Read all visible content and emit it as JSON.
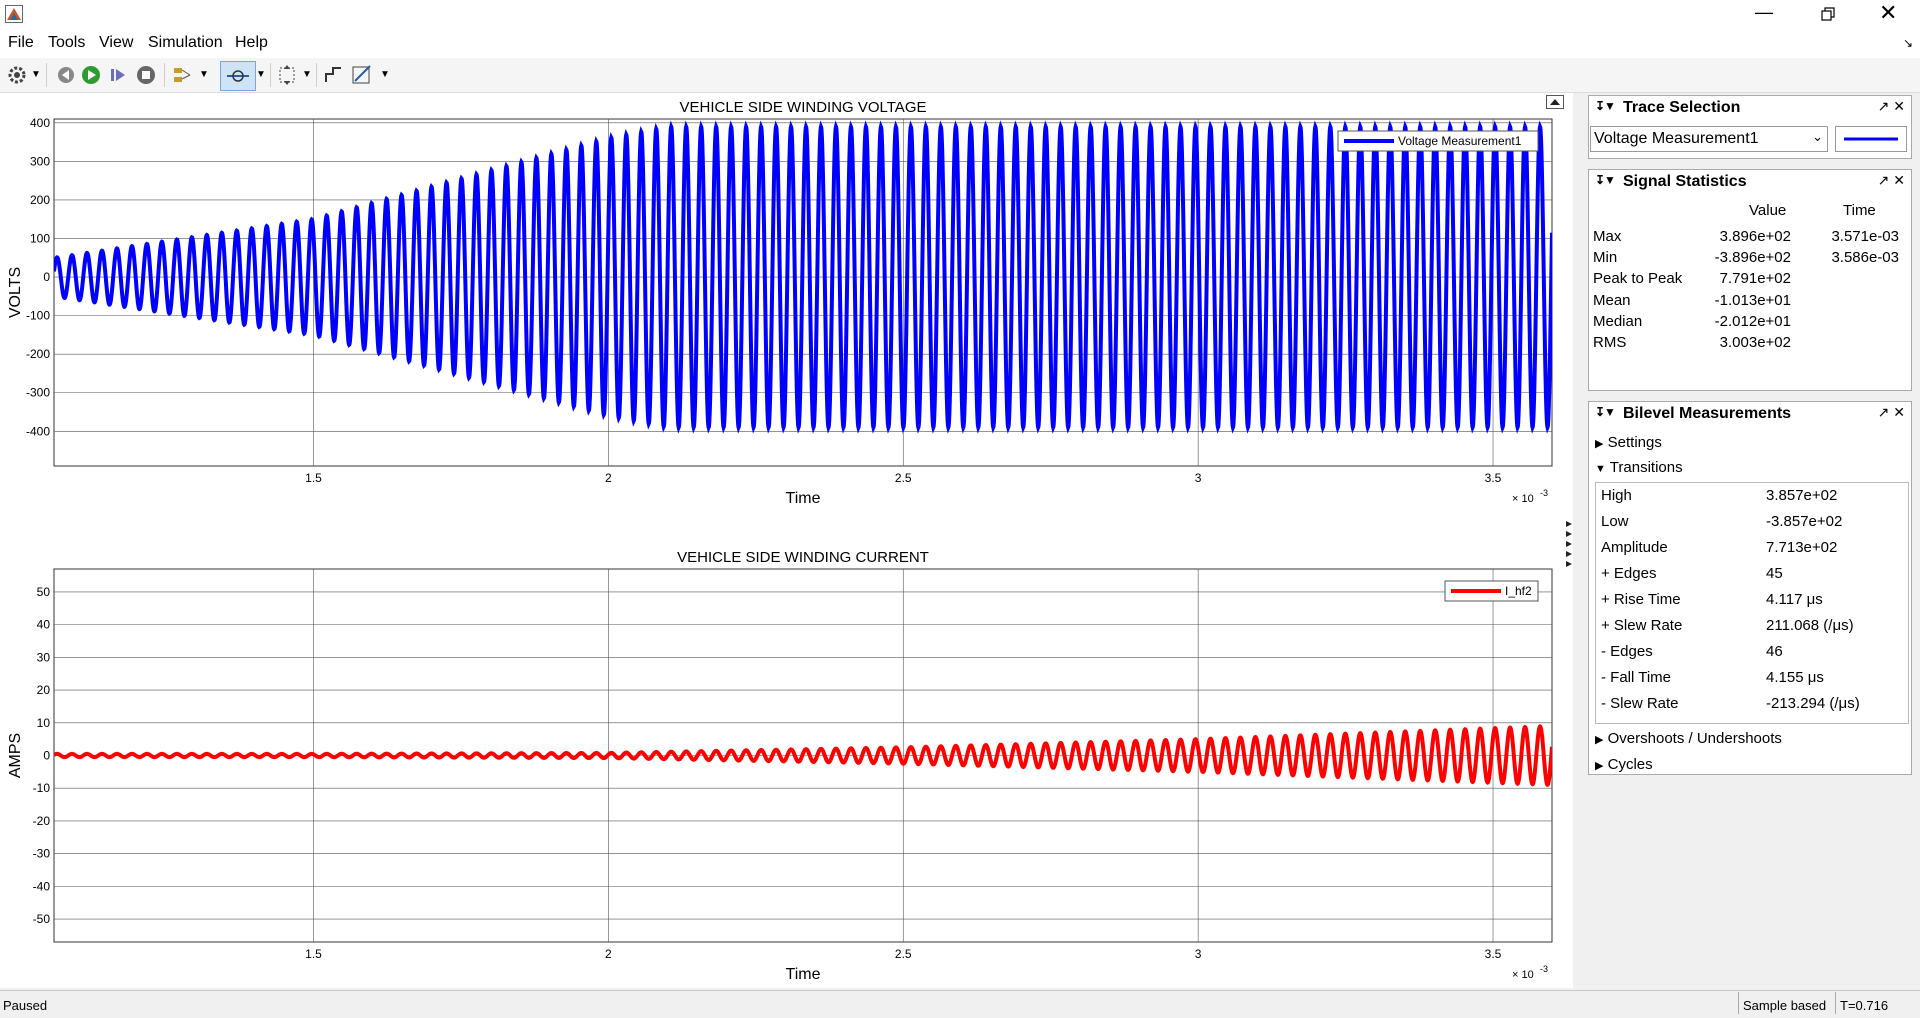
{
  "menu": [
    "File",
    "Tools",
    "View",
    "Simulation",
    "Help"
  ],
  "plots": [
    {
      "title": "VEHICLE SIDE WINDING VOLTAGE",
      "ylabel": "VOLTS",
      "xlabel": "Time",
      "exponent": "× 10",
      "exponent_power": "-3",
      "xticks": [
        "1.5",
        "2",
        "2.5",
        "3",
        "3.5"
      ],
      "yticks": [
        "400",
        "300",
        "200",
        "100",
        "0",
        "-100",
        "-200",
        "-300",
        "-400"
      ],
      "legend": "Voltage Measurement1",
      "color": "#0000ff"
    },
    {
      "title": "VEHICLE SIDE WINDING CURRENT",
      "ylabel": "AMPS",
      "xlabel": "Time",
      "exponent": "× 10",
      "exponent_power": "-3",
      "xticks": [
        "1.5",
        "2",
        "2.5",
        "3",
        "3.5"
      ],
      "yticks": [
        "50",
        "40",
        "30",
        "20",
        "10",
        "0",
        "-10",
        "-20",
        "-30",
        "-40",
        "-50"
      ],
      "legend": "I_hf2",
      "color": "#ff0000"
    }
  ],
  "chart_data": [
    {
      "type": "line",
      "title": "VEHICLE SIDE WINDING VOLTAGE",
      "xlabel": "Time",
      "ylabel": "VOLTS",
      "xlim": [
        0.00106,
        0.0036
      ],
      "ylim": [
        -490,
        410
      ],
      "grid": true,
      "legend_position": "top-right",
      "series": [
        {
          "name": "Voltage Measurement1",
          "waveform": "sinusoid",
          "x": [
            0.00106,
            0.0015,
            0.002,
            0.0021,
            0.0025,
            0.003,
            0.0036
          ],
          "amplitude": [
            50,
            150,
            360,
            389.6,
            389.6,
            389.6,
            389.6
          ],
          "cycles_over_range": 100
        }
      ]
    },
    {
      "type": "line",
      "title": "VEHICLE SIDE WINDING CURRENT",
      "xlabel": "Time",
      "ylabel": "AMPS",
      "xlim": [
        0.00106,
        0.0036
      ],
      "ylim": [
        -57,
        57
      ],
      "grid": true,
      "legend_position": "top-right",
      "series": [
        {
          "name": "I_hf2",
          "waveform": "sinusoid",
          "x": [
            0.00106,
            0.0015,
            0.002,
            0.0025,
            0.003,
            0.0036
          ],
          "amplitude": [
            0.5,
            0.5,
            0.8,
            2.5,
            5,
            9
          ],
          "cycles_over_range": 100
        }
      ]
    }
  ],
  "trace_selection": {
    "title": "Trace Selection",
    "selected": "Voltage Measurement1",
    "line_color": "#0000ff"
  },
  "signal_statistics": {
    "title": "Signal Statistics",
    "col_value": "Value",
    "col_time": "Time",
    "rows": [
      {
        "label": "Max",
        "value": "3.896e+02",
        "time": "3.571e-03"
      },
      {
        "label": "Min",
        "value": "-3.896e+02",
        "time": "3.586e-03"
      },
      {
        "label": "Peak to Peak",
        "value": "7.791e+02",
        "time": ""
      },
      {
        "label": "Mean",
        "value": "-1.013e+01",
        "time": ""
      },
      {
        "label": "Median",
        "value": "-2.012e+01",
        "time": ""
      },
      {
        "label": "RMS",
        "value": "3.003e+02",
        "time": ""
      }
    ]
  },
  "bilevel": {
    "title": "Bilevel Measurements",
    "settings": "Settings",
    "transitions": "Transitions",
    "rows": [
      {
        "label": "High",
        "value": "3.857e+02"
      },
      {
        "label": "Low",
        "value": "-3.857e+02"
      },
      {
        "label": "Amplitude",
        "value": "7.713e+02"
      },
      {
        "label": "+ Edges",
        "value": "45"
      },
      {
        "label": "+ Rise Time",
        "value": "4.117 μs"
      },
      {
        "label": "+ Slew Rate",
        "value": "211.068 (/μs)"
      },
      {
        "label": "- Edges",
        "value": "46"
      },
      {
        "label": "- Fall Time",
        "value": "4.155 μs"
      },
      {
        "label": "- Slew Rate",
        "value": "-213.294 (/μs)"
      }
    ],
    "overshoots": "Overshoots / Undershoots",
    "cycles": "Cycles"
  },
  "status": {
    "left": "Paused",
    "mode": "Sample based",
    "time": "T=0.716"
  }
}
